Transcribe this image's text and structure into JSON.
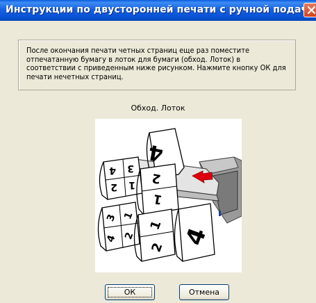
{
  "window": {
    "title": "Инструкции по двусторонней печати с ручной подаче..."
  },
  "instructions": {
    "text": "После окончания печати четных страниц еще раз поместите отпечатанную бумагу в лоток для бумаги (обход. Лоток) в соответствии с приведенным ниже рисунком. Нажмите кнопку ОК для печати нечетных страниц."
  },
  "illustration": {
    "caption": "Обход. Лоток",
    "page_labels": [
      "4",
      "3",
      "2",
      "1",
      "3",
      "4",
      "1",
      "2",
      "2",
      "1",
      "4"
    ]
  },
  "buttons": {
    "ok": "ОК",
    "cancel": "Отмена"
  },
  "colors": {
    "titlebar": "#0a5ce0",
    "close": "#d4401c",
    "dialog_bg": "#ece9d8"
  }
}
